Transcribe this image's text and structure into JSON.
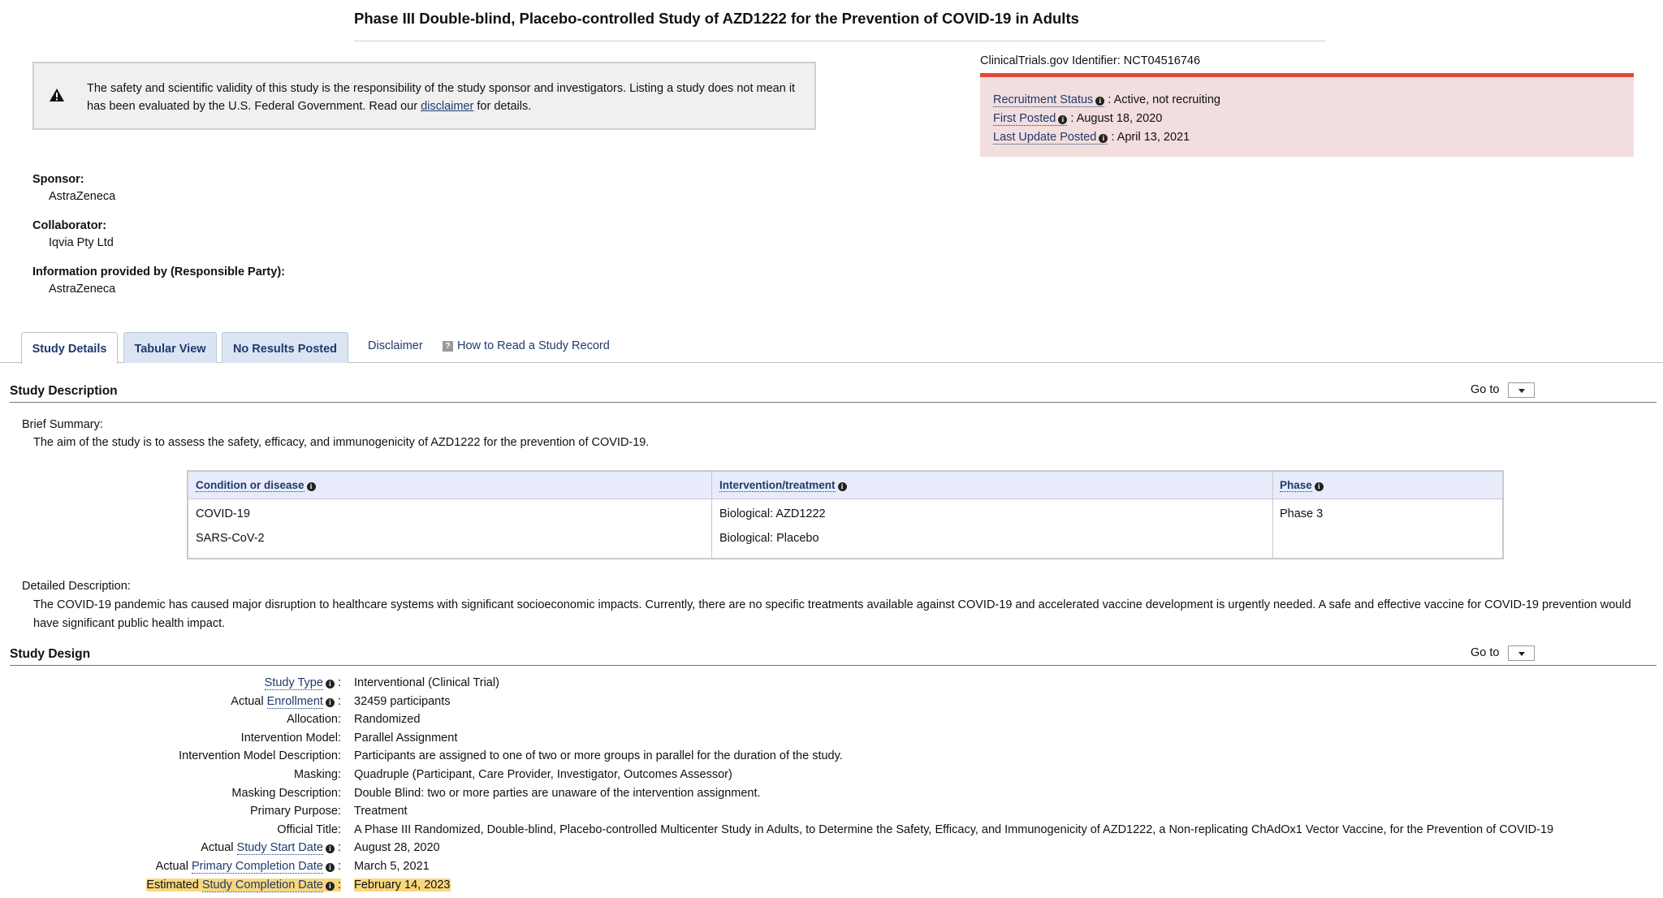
{
  "header": {
    "title": "Phase III Double-blind, Placebo-controlled Study of AZD1222 for the Prevention of COVID-19 in Adults"
  },
  "notice": {
    "text_before": "The safety and scientific validity of this study is the responsibility of the study sponsor and investigators. Listing a study does not mean it has been evaluated by the U.S. Federal Government. Read our ",
    "link": "disclaimer",
    "text_after": " for details."
  },
  "status": {
    "identifier": "ClinicalTrials.gov Identifier: NCT04516746",
    "recruitment_label": "Recruitment Status",
    "recruitment_value": " : Active, not recruiting",
    "first_posted_label": "First Posted",
    "first_posted_value": " : August 18, 2020",
    "last_update_label": "Last Update Posted",
    "last_update_value": " : April 13, 2021",
    "accent_color": "#e2493b",
    "panel_color": "#f2dede"
  },
  "sponsor": {
    "sponsor_label": "Sponsor:",
    "sponsor_value": "AstraZeneca",
    "collaborator_label": "Collaborator:",
    "collaborator_value": "Iqvia Pty Ltd",
    "responsible_label": "Information provided by (Responsible Party):",
    "responsible_value": "AstraZeneca"
  },
  "tabs": [
    {
      "label": "Study Details",
      "active": true
    },
    {
      "label": "Tabular View",
      "active": false
    },
    {
      "label": "No Results Posted",
      "active": false
    }
  ],
  "tab_links": {
    "disclaimer": "Disclaimer",
    "how_to": "How to Read a Study Record",
    "help_glyph": "?"
  },
  "description": {
    "heading": "Study Description",
    "goto": "Go to",
    "brief_label": "Brief Summary:",
    "brief_text": "The aim of the study is to assess the safety, efficacy, and immunogenicity of AZD1222 for the prevention of COVID-19.",
    "table": {
      "headers": [
        "Condition or disease",
        "Intervention/treatment",
        "Phase"
      ],
      "conditions": [
        "COVID-19",
        "SARS-CoV-2"
      ],
      "interventions": [
        "Biological: AZD1222",
        "Biological: Placebo"
      ],
      "phases": [
        "Phase 3"
      ]
    },
    "detailed_label": "Detailed Description:",
    "detailed_line1": "The COVID-19 pandemic has caused major disruption to healthcare systems with significant socioeconomic impacts. Currently, there are no specific treatments available against COVID-19 and accelerated vaccine development is urgently needed. A safe and effective vaccine for COVID-19 prevention would",
    "detailed_line2": "have significant public health impact."
  },
  "design": {
    "heading": "Study Design",
    "goto": "Go to",
    "rows": [
      {
        "prefix": "",
        "label": "Study Type",
        "linked": true,
        "value": "Interventional  (Clinical Trial)"
      },
      {
        "prefix": "Actual ",
        "label": "Enrollment",
        "linked": true,
        "value": "32459 participants"
      },
      {
        "prefix": "",
        "label": "Allocation:",
        "linked": false,
        "value": "Randomized"
      },
      {
        "prefix": "",
        "label": "Intervention Model:",
        "linked": false,
        "value": "Parallel Assignment"
      },
      {
        "prefix": "",
        "label": "Intervention Model Description:",
        "linked": false,
        "value": "Participants are assigned to one of two or more groups in parallel for the duration of the study."
      },
      {
        "prefix": "",
        "label": "Masking:",
        "linked": false,
        "value": "Quadruple (Participant, Care Provider, Investigator, Outcomes Assessor)"
      },
      {
        "prefix": "",
        "label": "Masking Description:",
        "linked": false,
        "value": "Double Blind: two or more parties are unaware of the intervention assignment."
      },
      {
        "prefix": "",
        "label": "Primary Purpose:",
        "linked": false,
        "value": "Treatment"
      },
      {
        "prefix": "",
        "label": "Official Title:",
        "linked": false,
        "value": "A Phase III Randomized, Double-blind, Placebo-controlled Multicenter Study in Adults, to Determine the Safety, Efficacy, and Immunogenicity of AZD1222, a Non-replicating ChAdOx1 Vector Vaccine, for the Prevention of COVID-19"
      },
      {
        "prefix": "Actual ",
        "label": "Study Start Date",
        "linked": true,
        "value": "August 28, 2020"
      },
      {
        "prefix": "Actual ",
        "label": "Primary Completion Date",
        "linked": true,
        "value": "March 5, 2021"
      },
      {
        "prefix": "Estimated ",
        "label": "Study Completion Date",
        "linked": true,
        "value": "February 14, 2023",
        "highlight": true
      }
    ],
    "highlight_color": "#f9d77e"
  }
}
